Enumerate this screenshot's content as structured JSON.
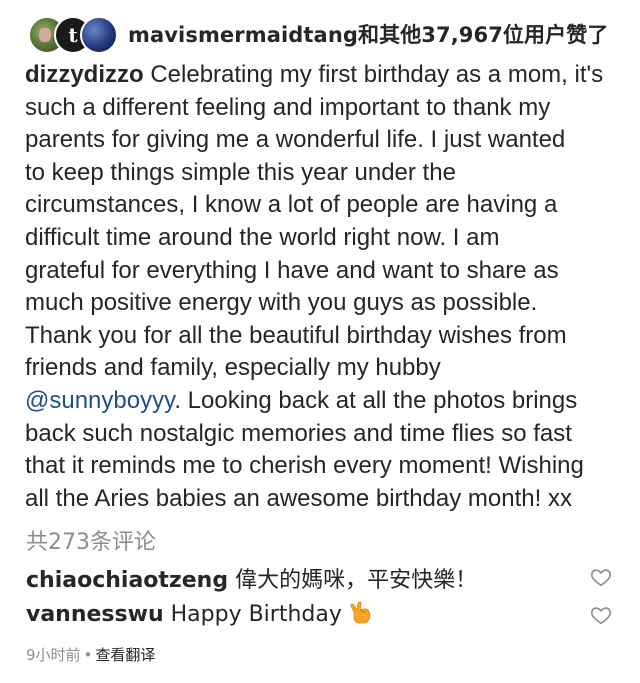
{
  "likes": {
    "avatar2_letter": "t",
    "text": "mavismermaidtang和其他37,967位用户赞了"
  },
  "caption": {
    "username": "dizzydizzo",
    "lines": [
      " Celebrating my first birthday as a mom, it's",
      "such a different feeling and important to thank my",
      "parents for giving me a wonderful life.  I just wanted",
      "to keep things simple this year under the",
      "circumstances, I know a lot of people are having a",
      "difficult time around the world right now.  I am",
      "grateful for everything I have and want to share as",
      "much positive energy with you guys as possible.",
      "Thank you for all the beautiful birthday wishes from",
      "friends and family, especially my hubby"
    ],
    "mention": "@sunnyboyyy",
    "after_mention": ". Looking back at all the photos brings",
    "lines_end": [
      "back such nostalgic memories and time flies so fast",
      "that it reminds me to cherish every moment!  Wishing",
      "all the Aries babies an awesome birthday month! xx"
    ]
  },
  "comments_count": "共273条评论",
  "comments": [
    {
      "user": "chiaochiaotzeng",
      "text": "偉大的媽咪，平安快樂！"
    },
    {
      "user": "vannesswu",
      "text": "Happy Birthday",
      "emoji": "crossed-fingers-emoji"
    }
  ],
  "meta": {
    "time": "9小时前",
    "dot": "•",
    "translate": "查看翻译"
  },
  "colors": {
    "text": "#262626",
    "secondary": "#8e8e8e",
    "mention": "#1f4e8a",
    "emoji": "#f5a623"
  }
}
